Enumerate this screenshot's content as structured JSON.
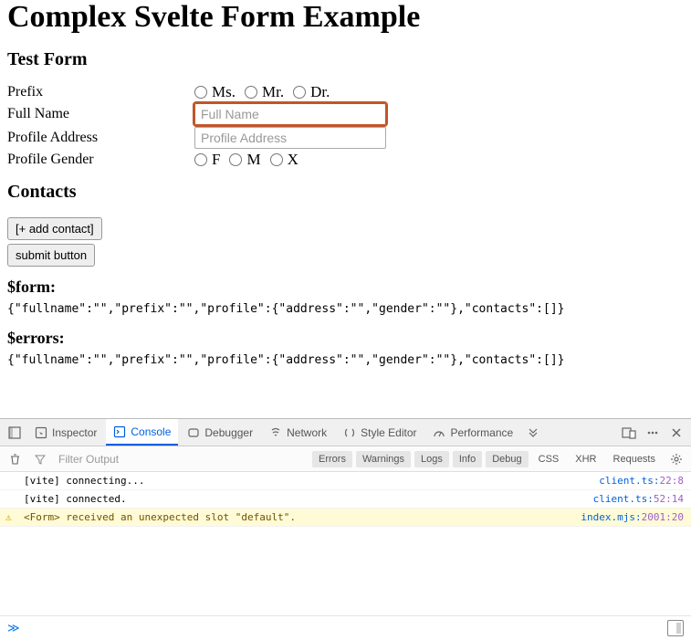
{
  "page": {
    "title": "Complex Svelte Form Example",
    "form_heading": "Test Form",
    "contacts_heading": "Contacts"
  },
  "fields": {
    "prefix": {
      "label": "Prefix",
      "options": [
        "Ms.",
        "Mr.",
        "Dr."
      ]
    },
    "fullname": {
      "label": "Full Name",
      "placeholder": "Full Name",
      "value": ""
    },
    "address": {
      "label": "Profile Address",
      "placeholder": "Profile Address",
      "value": ""
    },
    "gender": {
      "label": "Profile Gender",
      "options": [
        "F",
        "M",
        "X"
      ]
    }
  },
  "buttons": {
    "add_contact": "[+ add contact]",
    "submit": "submit button"
  },
  "state": {
    "form_label": "$form:",
    "form_value": "{\"fullname\":\"\",\"prefix\":\"\",\"profile\":{\"address\":\"\",\"gender\":\"\"},\"contacts\":[]}",
    "errors_label": "$errors:",
    "errors_value": "{\"fullname\":\"\",\"prefix\":\"\",\"profile\":{\"address\":\"\",\"gender\":\"\"},\"contacts\":[]}"
  },
  "devtools": {
    "tabs": {
      "inspector": "Inspector",
      "console": "Console",
      "debugger": "Debugger",
      "network": "Network",
      "style": "Style Editor",
      "perf": "Performance"
    },
    "filter_placeholder": "Filter Output",
    "pills": {
      "errors": "Errors",
      "warnings": "Warnings",
      "logs": "Logs",
      "info": "Info",
      "debug": "Debug",
      "css": "CSS",
      "xhr": "XHR",
      "requests": "Requests"
    },
    "logs": [
      {
        "msg": "[vite] connecting...",
        "src": "client.ts",
        "line": "22:8",
        "type": "log"
      },
      {
        "msg": "[vite] connected.",
        "src": "client.ts",
        "line": "52:14",
        "type": "log"
      },
      {
        "msg": "<Form> received an unexpected slot \"default\".",
        "src": "index.mjs",
        "line": "2001:20",
        "type": "warn"
      }
    ]
  }
}
